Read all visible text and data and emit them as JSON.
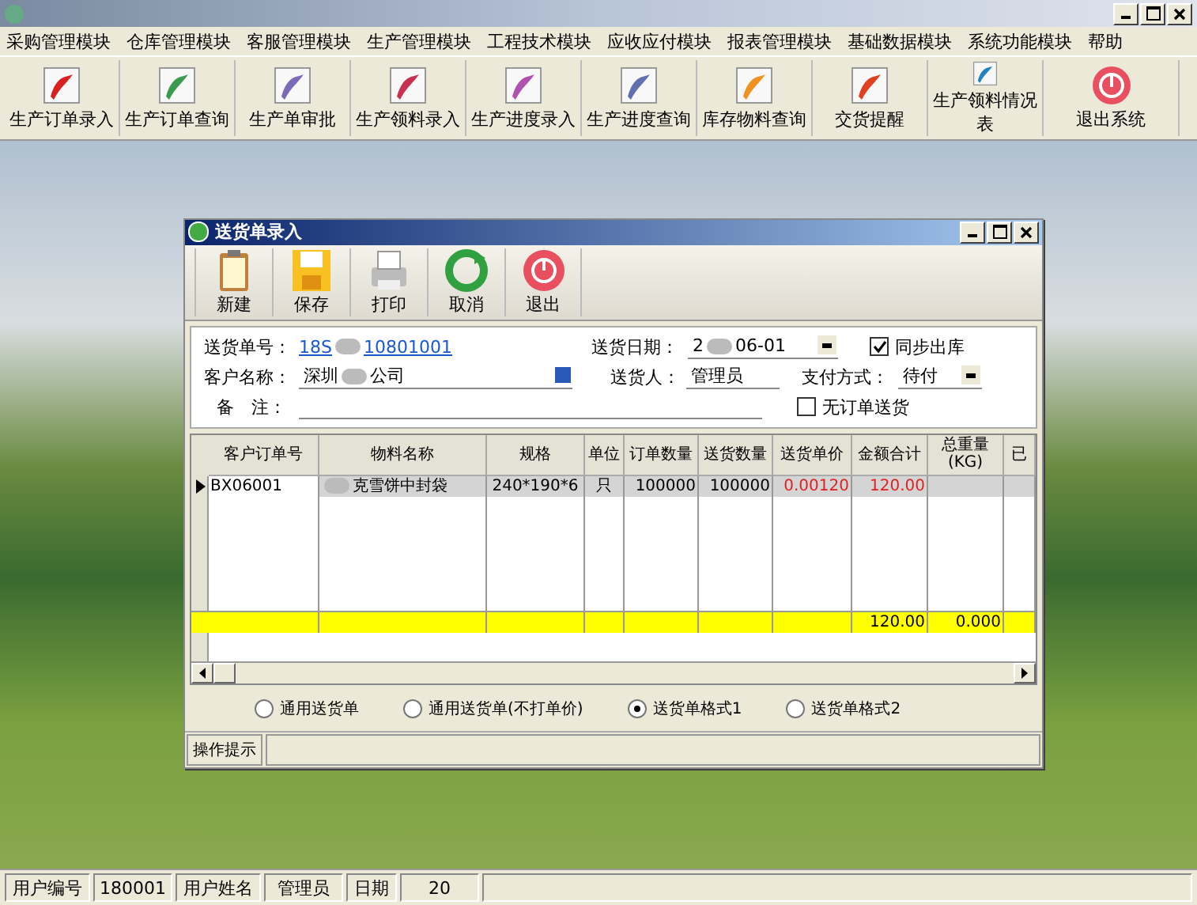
{
  "menu": [
    "采购管理模块",
    "仓库管理模块",
    "客服管理模块",
    "生产管理模块",
    "工程技术模块",
    "应收应付模块",
    "报表管理模块",
    "基础数据模块",
    "系统功能模块",
    "帮助"
  ],
  "toolbar": [
    "生产订单录入",
    "生产订单查询",
    "生产单审批",
    "生产领料录入",
    "生产进度录入",
    "生产进度查询",
    "库存物料查询",
    "交货提醒",
    "生产领料情况表",
    "退出系统"
  ],
  "child_window": {
    "title": "送货单录入",
    "toolbar": [
      "新建",
      "保存",
      "打印",
      "取消",
      "退出"
    ],
    "form": {
      "order_no_label": "送货单号：",
      "order_no_start": "18S",
      "order_no_end": "10801001",
      "date_label": "送货日期：",
      "date_start": "2",
      "date_end": "06-01",
      "sync_label": "同步出库",
      "sync_checked": true,
      "customer_label": "客户名称：",
      "customer_start": "深圳",
      "customer_end": "公司",
      "deliverer_label": "送货人：",
      "deliverer": "管理员",
      "payment_label": "支付方式：",
      "payment": "待付",
      "remark_label": "备　注：",
      "no_order_label": "无订单送货",
      "no_order_checked": false
    },
    "table": {
      "columns": [
        "客户订单号",
        "物料名称",
        "规格",
        "单位",
        "订单数量",
        "送货数量",
        "送货单价",
        "金额合计",
        "总重量\n(KG)",
        "已"
      ],
      "rows": [
        {
          "current": true,
          "cells": [
            "BX06001",
            "克雪饼中封袋",
            "240*190*6",
            "只",
            "100000",
            "100000",
            "0.00120",
            "120.00",
            "",
            ""
          ]
        }
      ],
      "totals": {
        "amount": "120.00",
        "weight": "0.000"
      }
    },
    "print_formats": [
      {
        "label": "通用送货单",
        "selected": false
      },
      {
        "label": "通用送货单(不打单价)",
        "selected": false
      },
      {
        "label": "送货单格式1",
        "selected": true
      },
      {
        "label": "送货单格式2",
        "selected": false
      }
    ],
    "hint_label": "操作提示"
  },
  "status_bar": [
    {
      "label": "用户编号",
      "value": "180001"
    },
    {
      "label": "用户姓名",
      "value": "管理员"
    },
    {
      "label": "日期",
      "value": "20"
    }
  ]
}
